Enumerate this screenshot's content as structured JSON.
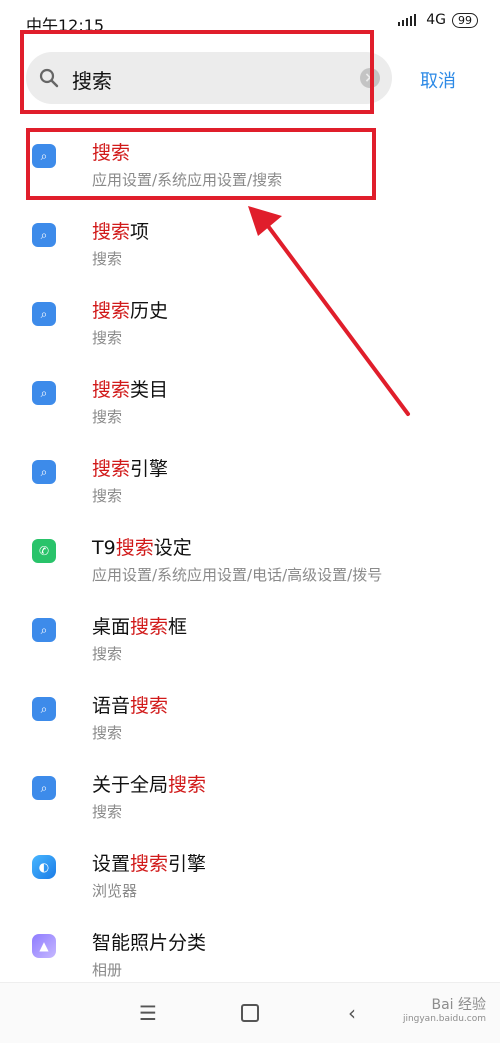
{
  "status_bar": {
    "time": "中午12:15",
    "network": "4G",
    "battery": "99"
  },
  "search": {
    "query": "搜索",
    "cancel_label": "取消"
  },
  "results": [
    {
      "icon": "settings-icon",
      "pre": "",
      "hl": "搜索",
      "post": "",
      "sub": "应用设置/系统应用设置/搜索"
    },
    {
      "icon": "settings-icon",
      "pre": "",
      "hl": "搜索",
      "post": "项",
      "sub": "搜索"
    },
    {
      "icon": "settings-icon",
      "pre": "",
      "hl": "搜索",
      "post": "历史",
      "sub": "搜索"
    },
    {
      "icon": "settings-icon",
      "pre": "",
      "hl": "搜索",
      "post": "类目",
      "sub": "搜索"
    },
    {
      "icon": "settings-icon",
      "pre": "",
      "hl": "搜索",
      "post": "引擎",
      "sub": "搜索"
    },
    {
      "icon": "phone-icon",
      "pre": "T9",
      "hl": "搜索",
      "post": "设定",
      "sub": "应用设置/系统应用设置/电话/高级设置/拨号"
    },
    {
      "icon": "settings-icon",
      "pre": "桌面",
      "hl": "搜索",
      "post": "框",
      "sub": "搜索"
    },
    {
      "icon": "settings-icon",
      "pre": "语音",
      "hl": "搜索",
      "post": "",
      "sub": "搜索"
    },
    {
      "icon": "settings-icon",
      "pre": "关于全局",
      "hl": "搜索",
      "post": "",
      "sub": "搜索"
    },
    {
      "icon": "browser-icon",
      "pre": "设置",
      "hl": "搜索",
      "post": "引擎",
      "sub": "浏览器"
    },
    {
      "icon": "gallery-icon",
      "pre": "智能照片分类",
      "hl": "",
      "post": "",
      "sub": "相册"
    }
  ],
  "watermark": {
    "line1": "Bai 经验",
    "line2": "jingyan.baidu.com"
  },
  "colors": {
    "highlight": "#d11a1a",
    "annotation": "#e01e2b",
    "accent": "#2d8ae6"
  }
}
